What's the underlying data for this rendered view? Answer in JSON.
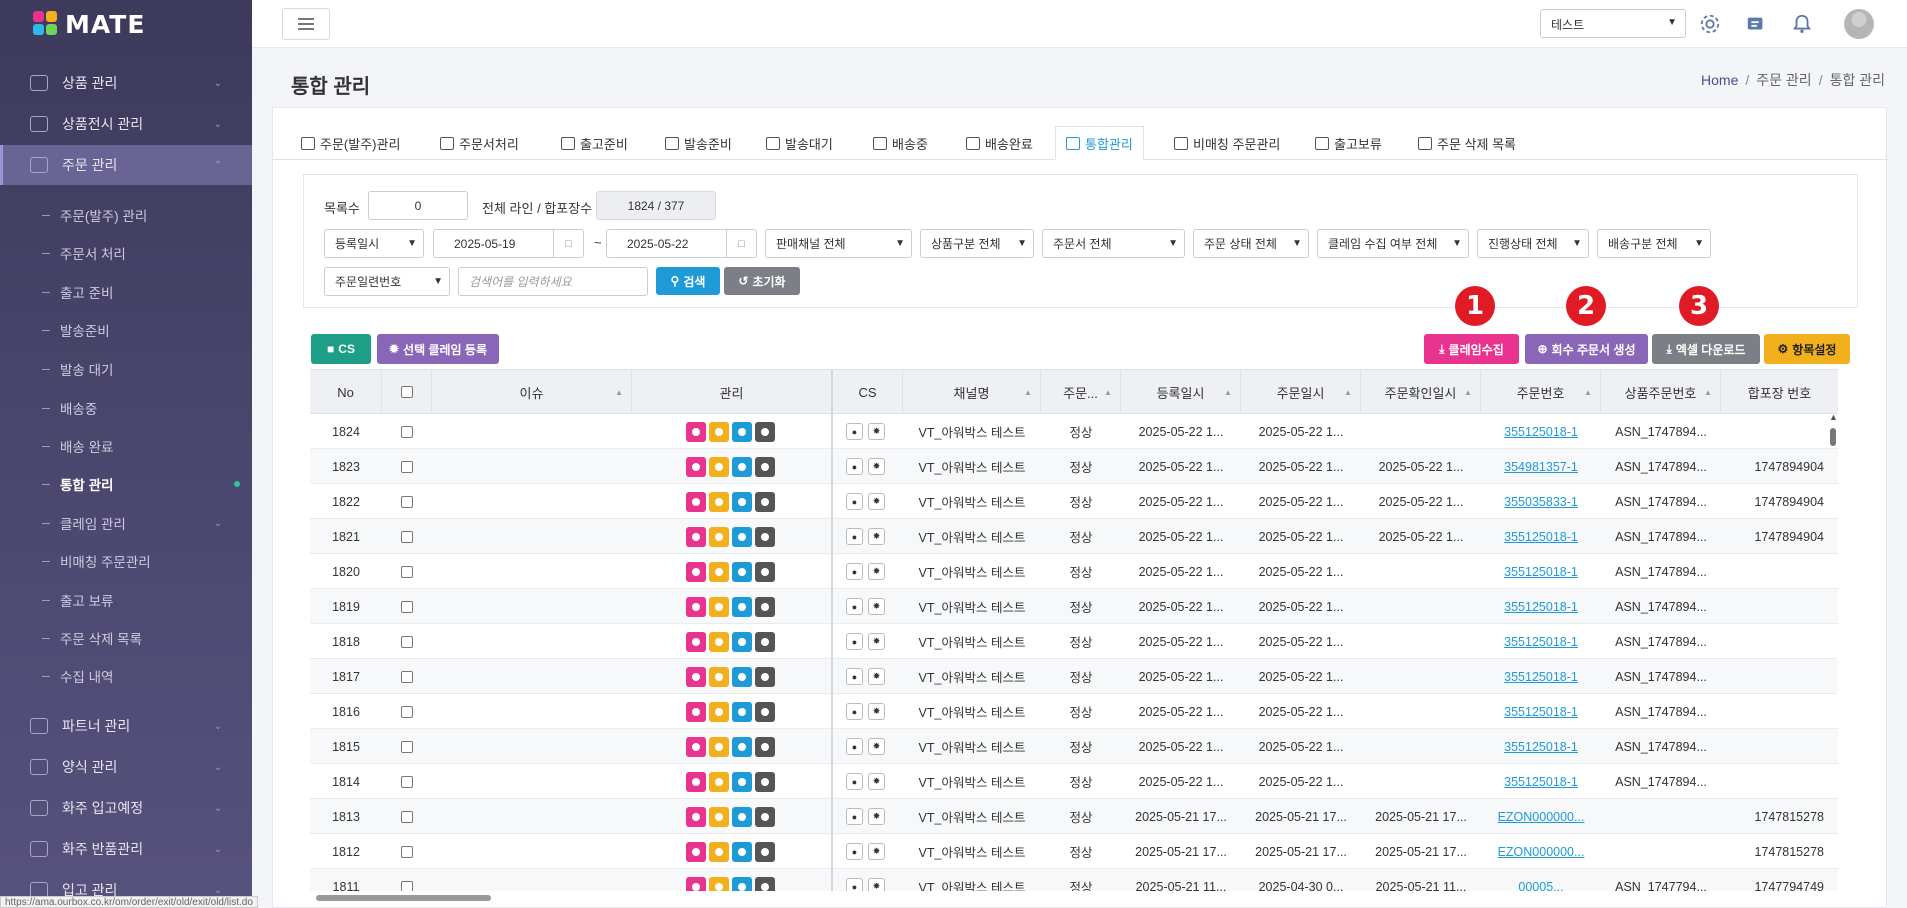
{
  "app": {
    "logo_text": "MATE"
  },
  "sidebar": {
    "groups": [
      {
        "label": "상품 관리",
        "icon": "box-icon"
      },
      {
        "label": "상품전시 관리",
        "icon": "store-icon"
      },
      {
        "label": "주문 관리",
        "icon": "cart-icon"
      }
    ],
    "order_items": [
      "주문(발주) 관리",
      "주문서 처리",
      "출고 준비",
      "발송준비",
      "발송 대기",
      "배송중",
      "배송 완료",
      "통합 관리",
      "클레임 관리",
      "비매칭 주문관리",
      "출고 보류",
      "주문 삭제 목록",
      "수집 내역"
    ],
    "lower_groups": [
      {
        "label": "파트너 관리",
        "icon": "handshake-icon"
      },
      {
        "label": "양식 관리",
        "icon": "file-icon"
      },
      {
        "label": "화주 입고예정",
        "icon": "truck-in-icon"
      },
      {
        "label": "화주 반품관리",
        "icon": "return-icon"
      },
      {
        "label": "입고 관리",
        "icon": "warehouse-icon"
      }
    ]
  },
  "topbar": {
    "tenant": "테스트"
  },
  "page": {
    "title": "통합 관리",
    "breadcrumb": [
      "Home",
      "주문 관리",
      "통합 관리"
    ]
  },
  "tabs": [
    "주문(발주)관리",
    "주문서처리",
    "출고준비",
    "발송준비",
    "발송대기",
    "배송중",
    "배송완료",
    "통합관리",
    "비매칭 주문관리",
    "출고보류",
    "주문 삭제 목록"
  ],
  "filters": {
    "count_label": "목록수",
    "count_value": "0",
    "total_label": "전체 라인 / 합포장수",
    "total_value": "1824 / 377",
    "date_type": "등록일시",
    "date_from": "2025-05-19",
    "date_to": "2025-05-22",
    "tilde": "~",
    "channel": "판매채널 전체",
    "product_type": "상품구분 전체",
    "order_form": "주문서 전체",
    "order_status": "주문 상태 전체",
    "claim_collect": "클레임 수집 여부 전체",
    "progress": "진행상태 전체",
    "delivery_type": "배송구분 전체",
    "search_field": "주문일련번호",
    "search_placeholder": "검색어를 입력하세요",
    "search_btn": "검색",
    "reset_btn": "초기화"
  },
  "actions": {
    "cs": "CS",
    "claim_register": "선택 클레임 등록",
    "claim_collect": "클레임수집",
    "create_return": "회수 주문서 생성",
    "excel_download": "엑셀 다운로드",
    "column_settings": "항목설정",
    "badges": [
      "1",
      "2",
      "3"
    ]
  },
  "table": {
    "headers": [
      "No",
      "",
      "이슈",
      "관리",
      "CS",
      "채널명",
      "주문...",
      "등록일시",
      "주문일시",
      "주문확인일시",
      "주문번호",
      "상품주문번호",
      "합포장 번호"
    ],
    "rows": [
      {
        "no": "1824",
        "channel": "VT_아워박스 테스트",
        "status": "정상",
        "reg": "2025-05-22 1...",
        "ord": "2025-05-22 1...",
        "conf": "",
        "order_no": "355125018-1",
        "prod_no": "ASN_1747894...",
        "pack": ""
      },
      {
        "no": "1823",
        "channel": "VT_아워박스 테스트",
        "status": "정상",
        "reg": "2025-05-22 1...",
        "ord": "2025-05-22 1...",
        "conf": "2025-05-22 1...",
        "order_no": "354981357-1",
        "prod_no": "ASN_1747894...",
        "pack": "1747894904"
      },
      {
        "no": "1822",
        "channel": "VT_아워박스 테스트",
        "status": "정상",
        "reg": "2025-05-22 1...",
        "ord": "2025-05-22 1...",
        "conf": "2025-05-22 1...",
        "order_no": "355035833-1",
        "prod_no": "ASN_1747894...",
        "pack": "1747894904"
      },
      {
        "no": "1821",
        "channel": "VT_아워박스 테스트",
        "status": "정상",
        "reg": "2025-05-22 1...",
        "ord": "2025-05-22 1...",
        "conf": "2025-05-22 1...",
        "order_no": "355125018-1",
        "prod_no": "ASN_1747894...",
        "pack": "1747894904"
      },
      {
        "no": "1820",
        "channel": "VT_아워박스 테스트",
        "status": "정상",
        "reg": "2025-05-22 1...",
        "ord": "2025-05-22 1...",
        "conf": "",
        "order_no": "355125018-1",
        "prod_no": "ASN_1747894...",
        "pack": ""
      },
      {
        "no": "1819",
        "channel": "VT_아워박스 테스트",
        "status": "정상",
        "reg": "2025-05-22 1...",
        "ord": "2025-05-22 1...",
        "conf": "",
        "order_no": "355125018-1",
        "prod_no": "ASN_1747894...",
        "pack": ""
      },
      {
        "no": "1818",
        "channel": "VT_아워박스 테스트",
        "status": "정상",
        "reg": "2025-05-22 1...",
        "ord": "2025-05-22 1...",
        "conf": "",
        "order_no": "355125018-1",
        "prod_no": "ASN_1747894...",
        "pack": ""
      },
      {
        "no": "1817",
        "channel": "VT_아워박스 테스트",
        "status": "정상",
        "reg": "2025-05-22 1...",
        "ord": "2025-05-22 1...",
        "conf": "",
        "order_no": "355125018-1",
        "prod_no": "ASN_1747894...",
        "pack": ""
      },
      {
        "no": "1816",
        "channel": "VT_아워박스 테스트",
        "status": "정상",
        "reg": "2025-05-22 1...",
        "ord": "2025-05-22 1...",
        "conf": "",
        "order_no": "355125018-1",
        "prod_no": "ASN_1747894...",
        "pack": ""
      },
      {
        "no": "1815",
        "channel": "VT_아워박스 테스트",
        "status": "정상",
        "reg": "2025-05-22 1...",
        "ord": "2025-05-22 1...",
        "conf": "",
        "order_no": "355125018-1",
        "prod_no": "ASN_1747894...",
        "pack": ""
      },
      {
        "no": "1814",
        "channel": "VT_아워박스 테스트",
        "status": "정상",
        "reg": "2025-05-22 1...",
        "ord": "2025-05-22 1...",
        "conf": "",
        "order_no": "355125018-1",
        "prod_no": "ASN_1747894...",
        "pack": ""
      },
      {
        "no": "1813",
        "channel": "VT_아워박스 테스트",
        "status": "정상",
        "reg": "2025-05-21 17...",
        "ord": "2025-05-21 17...",
        "conf": "2025-05-21 17...",
        "order_no": "EZON000000...",
        "prod_no": "",
        "pack": "1747815278"
      },
      {
        "no": "1812",
        "channel": "VT_아워박스 테스트",
        "status": "정상",
        "reg": "2025-05-21 17...",
        "ord": "2025-05-21 17...",
        "conf": "2025-05-21 17...",
        "order_no": "EZON000000...",
        "prod_no": "",
        "pack": "1747815278"
      },
      {
        "no": "1811",
        "channel": "VT_아워박스 테스트",
        "status": "정상",
        "reg": "2025-05-21 11...",
        "ord": "2025-04-30 0...",
        "conf": "2025-05-21 11...",
        "order_no": "00005...",
        "prod_no": "ASN_1747794...",
        "pack": "1747794749"
      }
    ]
  },
  "status_url": "https://ama.ourbox.co.kr/om/order/exit/old/exit/old/list.do",
  "colors": {
    "accent": "#1e9bd7",
    "pink": "#e8348e",
    "purple": "#8a66b8",
    "gray": "#7c7f85",
    "amber": "#f2b01c",
    "teal": "#1e9e87",
    "badge_red": "#e01b24"
  }
}
